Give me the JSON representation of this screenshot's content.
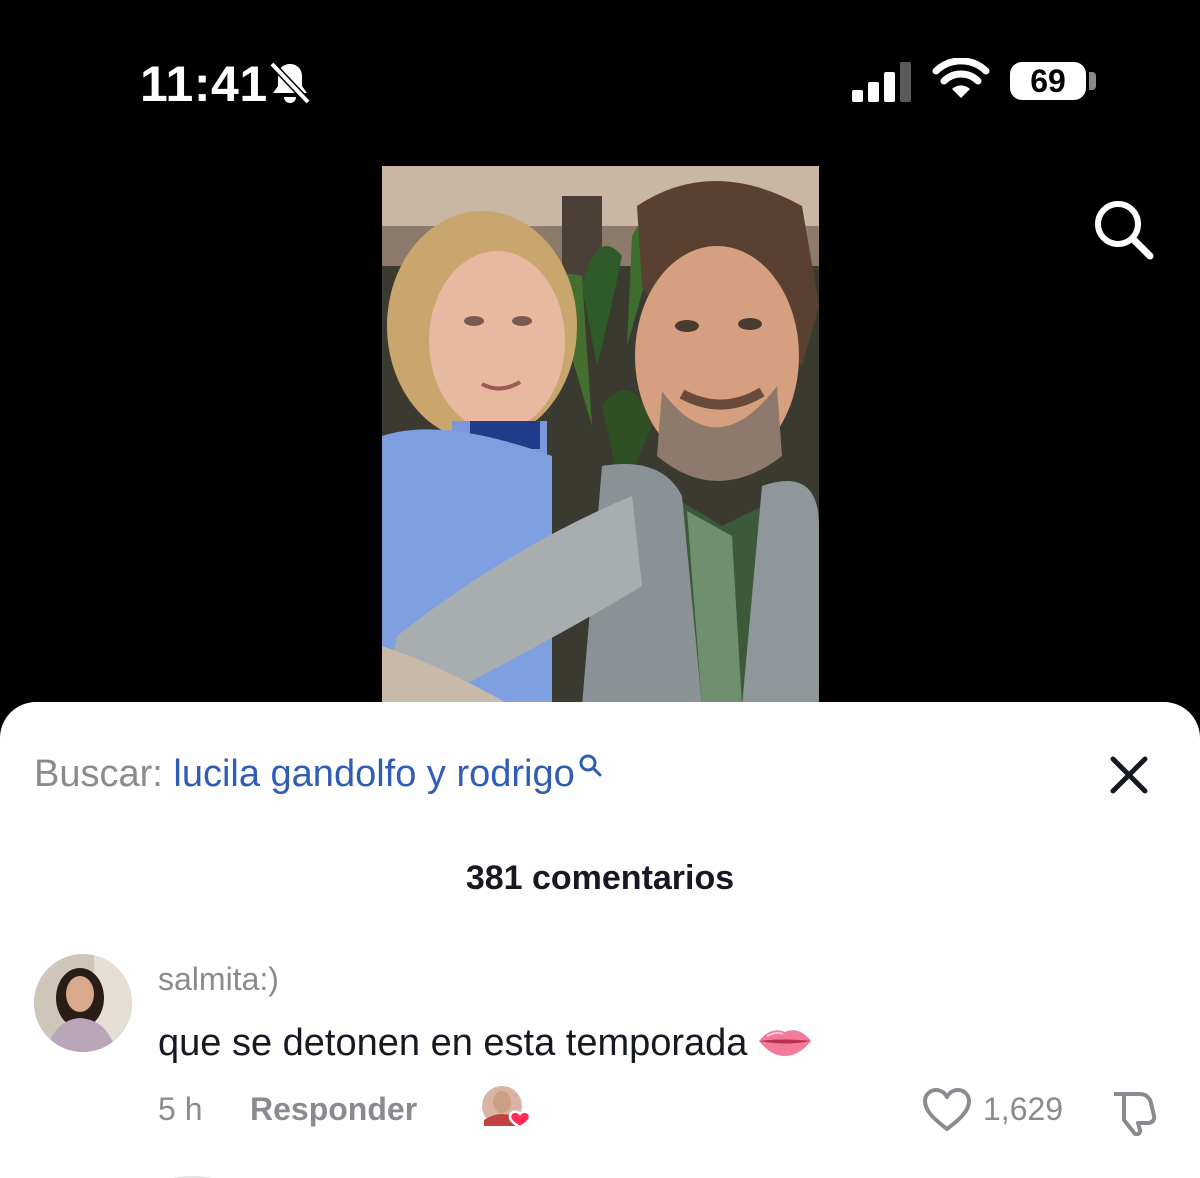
{
  "status_bar": {
    "time": "11:41",
    "battery_level": "69",
    "icons": [
      "bell-muted-icon",
      "cellular-signal-icon",
      "wifi-icon",
      "battery-icon"
    ]
  },
  "video": {
    "content_icon": "video-frame"
  },
  "header": {
    "search_icon": "search-icon"
  },
  "search_suggestion": {
    "prefix": "Buscar: ",
    "query": "lucila gandolfo y rodrigo",
    "icon": "search-icon"
  },
  "comments": {
    "count_label": "381 comentarios",
    "close_icon": "close-icon",
    "items": [
      {
        "username": "salmita:)",
        "text": "que se detonen en esta temporada",
        "emoji_icon": "lips-icon",
        "time": "5 h",
        "reply_label": "Responder",
        "likes": "1,629",
        "creator_liked": true
      }
    ]
  },
  "colors": {
    "sheet_background": "#ffffff",
    "link_blue": "#2f5db5",
    "secondary_text": "#8a8b91",
    "primary_text": "#161823",
    "like_pink": "#fe2c55"
  }
}
